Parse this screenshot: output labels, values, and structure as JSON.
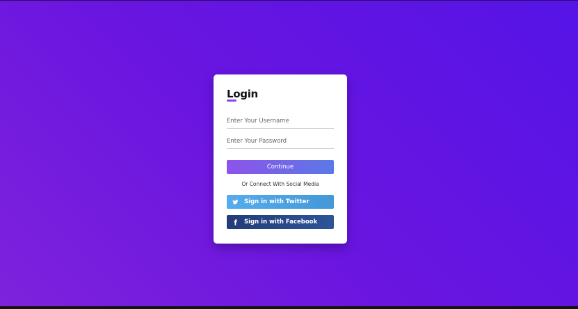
{
  "login": {
    "title": "Login",
    "username": {
      "placeholder": "Enter Your Username",
      "value": ""
    },
    "password": {
      "placeholder": "Enter Your Password",
      "value": ""
    },
    "continue_label": "Continue",
    "social_caption": "Or Connect With Social Media",
    "twitter_label": "Sign in with Twitter",
    "facebook_label": "Sign in with Facebook"
  },
  "icons": {
    "twitter": "twitter-icon",
    "facebook": "facebook-icon"
  },
  "colors": {
    "background_start": "#7e22dc",
    "background_end": "#5514e6",
    "accent": "#8b46e8",
    "continue_start": "#8d53ea",
    "continue_end": "#5a79e6",
    "twitter": "#55acee",
    "facebook": "#243b79"
  }
}
